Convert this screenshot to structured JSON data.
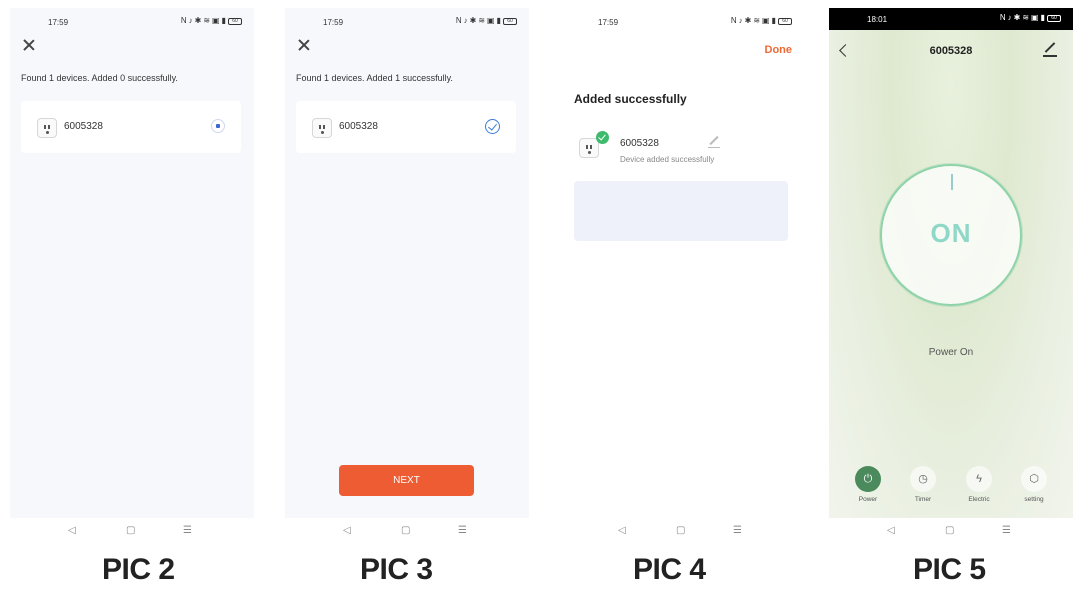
{
  "status": {
    "time_a": "17:59",
    "time_b": "18:01",
    "battery": "60"
  },
  "pic2": {
    "found_text": "Found 1 devices. Added 0 successfully.",
    "device_name": "6005328",
    "caption": "PIC 2"
  },
  "pic3": {
    "found_text": "Found 1 devices. Added 1 successfully.",
    "device_name": "6005328",
    "next_label": "NEXT",
    "caption": "PIC 3"
  },
  "pic4": {
    "done_label": "Done",
    "title": "Added successfully",
    "device_name": "6005328",
    "device_status": "Device added successfully",
    "caption": "PIC 4"
  },
  "pic5": {
    "title": "6005328",
    "dial_label": "ON",
    "power_state": "Power On",
    "tabs": [
      {
        "label": "Power",
        "icon": "power-icon"
      },
      {
        "label": "Timer",
        "icon": "timer-icon"
      },
      {
        "label": "Electric",
        "icon": "lightning-icon"
      },
      {
        "label": "setting",
        "icon": "settings-cube-icon"
      }
    ],
    "caption": "PIC 5"
  },
  "colors": {
    "accent_orange": "#ee5c34",
    "done_orange": "#ee6a34",
    "check_blue": "#3b7dd8",
    "success_green": "#3dba6c",
    "active_tab_green": "#4a8a5c"
  }
}
